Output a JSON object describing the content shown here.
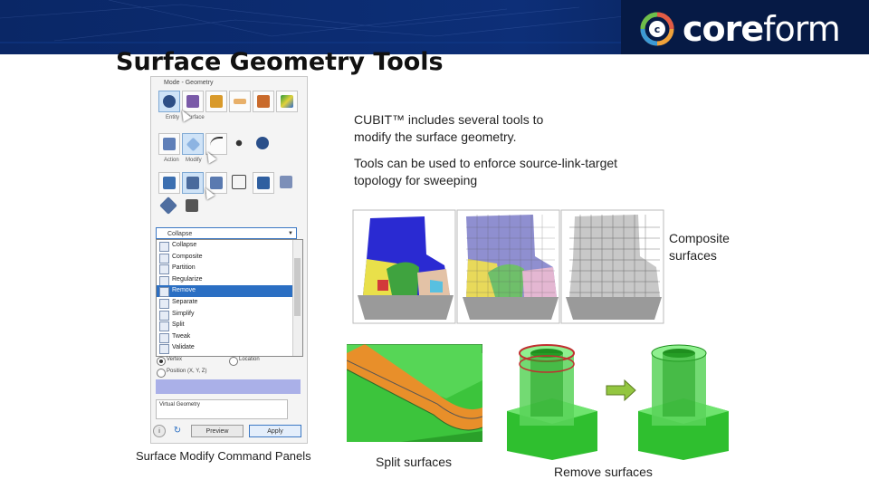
{
  "header": {
    "brand_name_bold": "core",
    "brand_name_light": "form",
    "colors": {
      "banner": "#0b2b6b",
      "banner_dark": "#061a45",
      "logo_ring": "#f0a23a"
    }
  },
  "slide": {
    "title": "Surface Geometry Tools",
    "text_1": "CUBIT™ includes several tools to modify the surface geometry.",
    "text_2": "Tools can be used to enforce source-link-target topology for sweeping",
    "label_composite": "Composite surfaces",
    "caption_panels": "Surface Modify Command Panels",
    "caption_split": "Split surfaces",
    "caption_remove": "Remove surfaces"
  },
  "panel": {
    "mode_label": "Mode - Geometry",
    "row1_caption_a": "Entity",
    "row1_caption_b": "Surface",
    "row2_caption_a": "Action",
    "row2_caption_b": "Modify",
    "combo_value": "Collapse",
    "operations": [
      "Collapse",
      "Composite",
      "Partition",
      "Regularize",
      "Remove",
      "Separate",
      "Simplify",
      "Split",
      "Tweak",
      "Validate"
    ],
    "selected_operation": "Remove",
    "radio_vertex": "Vertex",
    "radio_location": "Location",
    "radio_position": "Position (X, Y, Z)",
    "virtual_geometry": "Virtual Geometry",
    "info_icon": "i",
    "preview_label": "Preview",
    "apply_label": "Apply"
  },
  "icons": {
    "arrow": "arrow-right-icon",
    "logo": "coreform-logo-icon"
  }
}
